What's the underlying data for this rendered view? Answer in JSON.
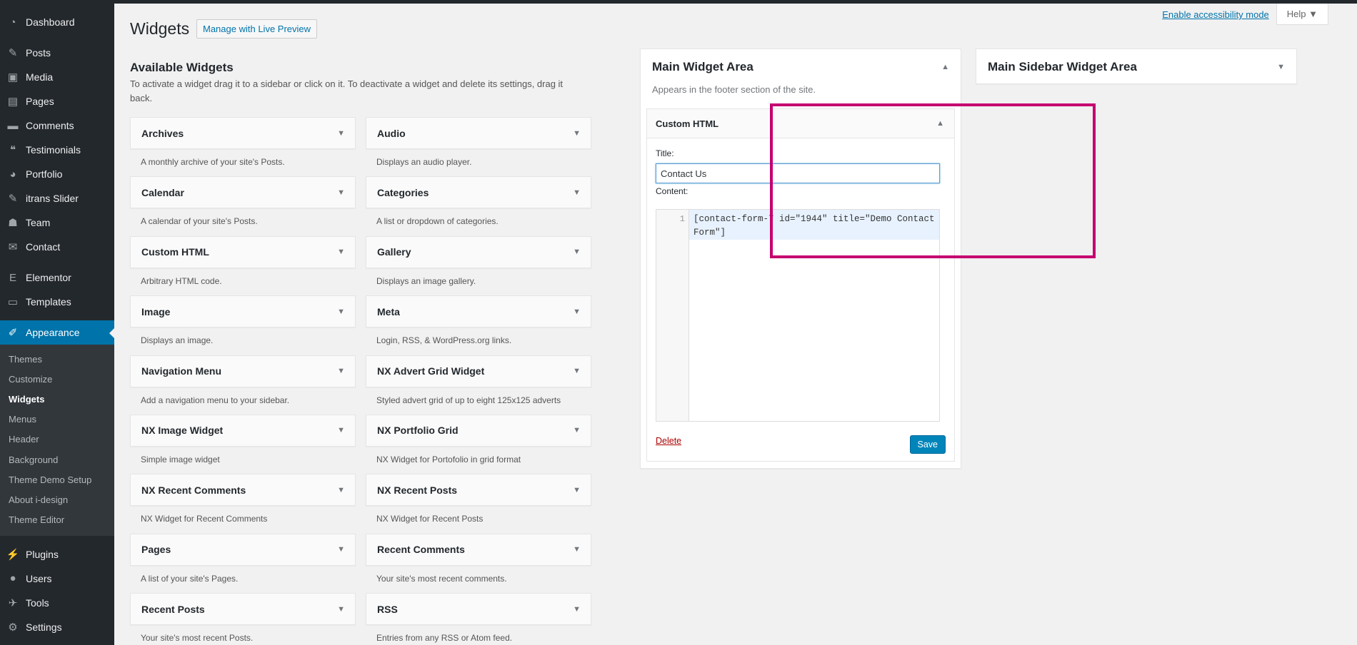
{
  "menu": {
    "top": [
      {
        "label": "Dashboard",
        "icon": "dashboard-icon",
        "glyph": "◔"
      }
    ],
    "group1": [
      {
        "label": "Posts",
        "icon": "pin-icon",
        "glyph": "✎"
      },
      {
        "label": "Media",
        "icon": "media-icon",
        "glyph": "▣"
      },
      {
        "label": "Pages",
        "icon": "page-icon",
        "glyph": "▤"
      },
      {
        "label": "Comments",
        "icon": "comment-icon",
        "glyph": "▬"
      },
      {
        "label": "Testimonials",
        "icon": "quote-icon",
        "glyph": "❝"
      },
      {
        "label": "Portfolio",
        "icon": "portfolio-icon",
        "glyph": "◕"
      },
      {
        "label": "itrans Slider",
        "icon": "pin-icon",
        "glyph": "✎"
      },
      {
        "label": "Team",
        "icon": "team-icon",
        "glyph": "☗"
      },
      {
        "label": "Contact",
        "icon": "email-icon",
        "glyph": "✉"
      }
    ],
    "group2": [
      {
        "label": "Elementor",
        "icon": "elementor-icon",
        "glyph": "E"
      },
      {
        "label": "Templates",
        "icon": "folder-icon",
        "glyph": "▭"
      }
    ],
    "appearance": {
      "label": "Appearance",
      "icon": "brush-icon",
      "glyph": "✐"
    },
    "submenu": [
      "Themes",
      "Customize",
      "Widgets",
      "Menus",
      "Header",
      "Background",
      "Theme Demo Setup",
      "About i-design",
      "Theme Editor"
    ],
    "group3": [
      {
        "label": "Plugins",
        "icon": "plugin-icon",
        "glyph": "⚡"
      },
      {
        "label": "Users",
        "icon": "user-icon",
        "glyph": "●"
      },
      {
        "label": "Tools",
        "icon": "wrench-icon",
        "glyph": "✈"
      },
      {
        "label": "Settings",
        "icon": "settings-icon",
        "glyph": "⚙"
      }
    ]
  },
  "topbar": {
    "accessibility": "Enable accessibility mode",
    "help": "Help ▼"
  },
  "page": {
    "title": "Widgets",
    "live_preview": "Manage with Live Preview"
  },
  "available": {
    "heading": "Available Widgets",
    "description": "To activate a widget drag it to a sidebar or click on it. To deactivate a widget and delete its settings, drag it back.",
    "widgets": [
      {
        "name": "Archives",
        "desc": "A monthly archive of your site's Posts."
      },
      {
        "name": "Audio",
        "desc": "Displays an audio player."
      },
      {
        "name": "Calendar",
        "desc": "A calendar of your site's Posts."
      },
      {
        "name": "Categories",
        "desc": "A list or dropdown of categories."
      },
      {
        "name": "Custom HTML",
        "desc": "Arbitrary HTML code."
      },
      {
        "name": "Gallery",
        "desc": "Displays an image gallery."
      },
      {
        "name": "Image",
        "desc": "Displays an image."
      },
      {
        "name": "Meta",
        "desc": "Login, RSS, & WordPress.org links."
      },
      {
        "name": "Navigation Menu",
        "desc": "Add a navigation menu to your sidebar."
      },
      {
        "name": "NX Advert Grid Widget",
        "desc": "Styled advert grid of up to eight 125x125 adverts"
      },
      {
        "name": "NX Image Widget",
        "desc": "Simple image widget"
      },
      {
        "name": "NX Portfolio Grid",
        "desc": "NX Widget for Portofolio in grid format"
      },
      {
        "name": "NX Recent Comments",
        "desc": "NX Widget for Recent Comments"
      },
      {
        "name": "NX Recent Posts",
        "desc": "NX Widget for Recent Posts"
      },
      {
        "name": "Pages",
        "desc": "A list of your site's Pages."
      },
      {
        "name": "Recent Comments",
        "desc": "Your site's most recent comments."
      },
      {
        "name": "Recent Posts",
        "desc": "Your site's most recent Posts."
      },
      {
        "name": "RSS",
        "desc": "Entries from any RSS or Atom feed."
      }
    ]
  },
  "main_area": {
    "title": "Main Widget Area",
    "description": "Appears in the footer section of the site.",
    "widget": {
      "name": "Custom HTML",
      "title_label": "Title:",
      "title_value": "Contact Us",
      "content_label": "Content:",
      "line_number": "1",
      "code": "[contact-form-7 id=\"1944\" title=\"Demo Contact Form\"]",
      "delete": "Delete",
      "save": "Save"
    }
  },
  "sidebar_area": {
    "title": "Main Sidebar Widget Area"
  },
  "colors": {
    "highlight": "#c5006f",
    "accent": "#0073aa",
    "menu_bg": "#23282d"
  }
}
